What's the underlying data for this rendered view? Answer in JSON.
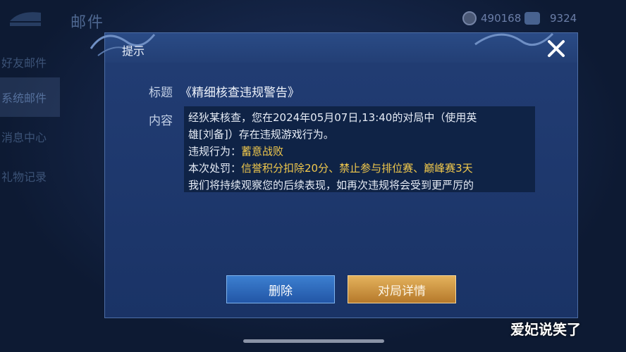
{
  "background": {
    "title": "邮件",
    "currency": [
      {
        "icon": "coin-icon",
        "value": "490168"
      },
      {
        "icon": "gem-icon",
        "value": "9324"
      }
    ],
    "sidebar": [
      "好友邮件",
      "系统邮件",
      "消息中心",
      "礼物记录"
    ]
  },
  "dialog": {
    "title": "提示",
    "subject_label": "标题",
    "subject_value": "《精细核查违规警告》",
    "content_label": "内容",
    "content": {
      "line1": "经狄某核查，您在2024年05月07日,13:40的对局中（使用英",
      "line2": "雄[刘备]）存在违规游戏行为。",
      "violation_label": "违规行为：",
      "violation_value": "蓄意战败",
      "penalty_label": "本次处罚：",
      "penalty_value": "信誉积分扣除20分、禁止参与排位赛、巅峰赛3天",
      "line5": "我们将持续观察您的后续表现，如再次违规将会受到更严厉的"
    },
    "delete_label": "删除",
    "detail_label": "对局详情"
  },
  "watermark": "爱妃说笑了",
  "colors": {
    "highlight": "#f2c94c",
    "dialog_bg": "#1a3366"
  }
}
